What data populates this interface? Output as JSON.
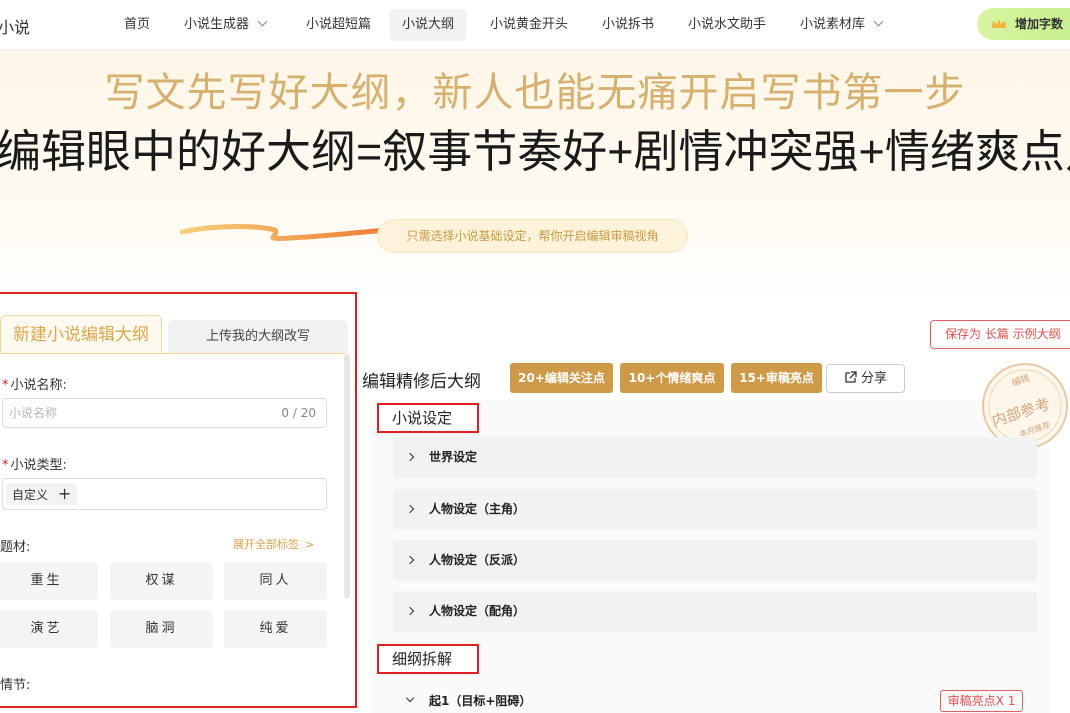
{
  "brand": {
    "logo_text": "小说"
  },
  "nav": {
    "items": [
      {
        "label": "首页"
      },
      {
        "label": "小说生成器"
      },
      {
        "label": "小说超短篇"
      },
      {
        "label": "小说大纲"
      },
      {
        "label": "小说黄金开头"
      },
      {
        "label": "小说拆书"
      },
      {
        "label": "小说水文助手"
      },
      {
        "label": "小说素材库"
      }
    ],
    "active_index": 3,
    "add_button_label": "增加字数"
  },
  "hero": {
    "subtitle": "写文先写好大纲，新人也能无痛开启写书第一步",
    "title": "编辑眼中的好大纲=叙事节奏好+剧情冲突强+情绪爽点足",
    "hint": "只需选择小说基础设定，帮你开启编辑审稿视角"
  },
  "form": {
    "tabs": {
      "new": "新建小说编辑大纲",
      "upload": "上传我的大纲改写"
    },
    "name_label": "小说名称:",
    "name_placeholder": "小说名称",
    "name_counter": "0 / 20",
    "type_label": "小说类型:",
    "type_tag": "自定义",
    "theme_label": "题材:",
    "expand_link": "展开全部标签",
    "themes": [
      "重生",
      "权谋",
      "同人",
      "演艺",
      "脑洞",
      "纯爱"
    ],
    "plot_label": "情节:"
  },
  "outline": {
    "save_button": "保存为 长篇 示例大纲",
    "title": "编辑精修后大纲",
    "badges": [
      "20+编辑关注点",
      "10+个情绪爽点",
      "15+审稿亮点"
    ],
    "share_label": "分享",
    "stamp": {
      "top": "编辑",
      "main": "内部参考",
      "bottom": "本月推荐"
    },
    "sections": [
      {
        "title": "小说设定",
        "rows": [
          "世界设定",
          "人物设定（主角）",
          "人物设定（反派）",
          "人物设定（配角）"
        ]
      },
      {
        "title": "细纲拆解",
        "rows": [
          "起1（目标+阻碍）"
        ]
      }
    ],
    "highlight_badge": "审稿亮点X 1"
  },
  "colors": {
    "accent_gold": "#cf9a48",
    "highlight_red": "#e02020",
    "hero_gold": "#d6b06f"
  }
}
